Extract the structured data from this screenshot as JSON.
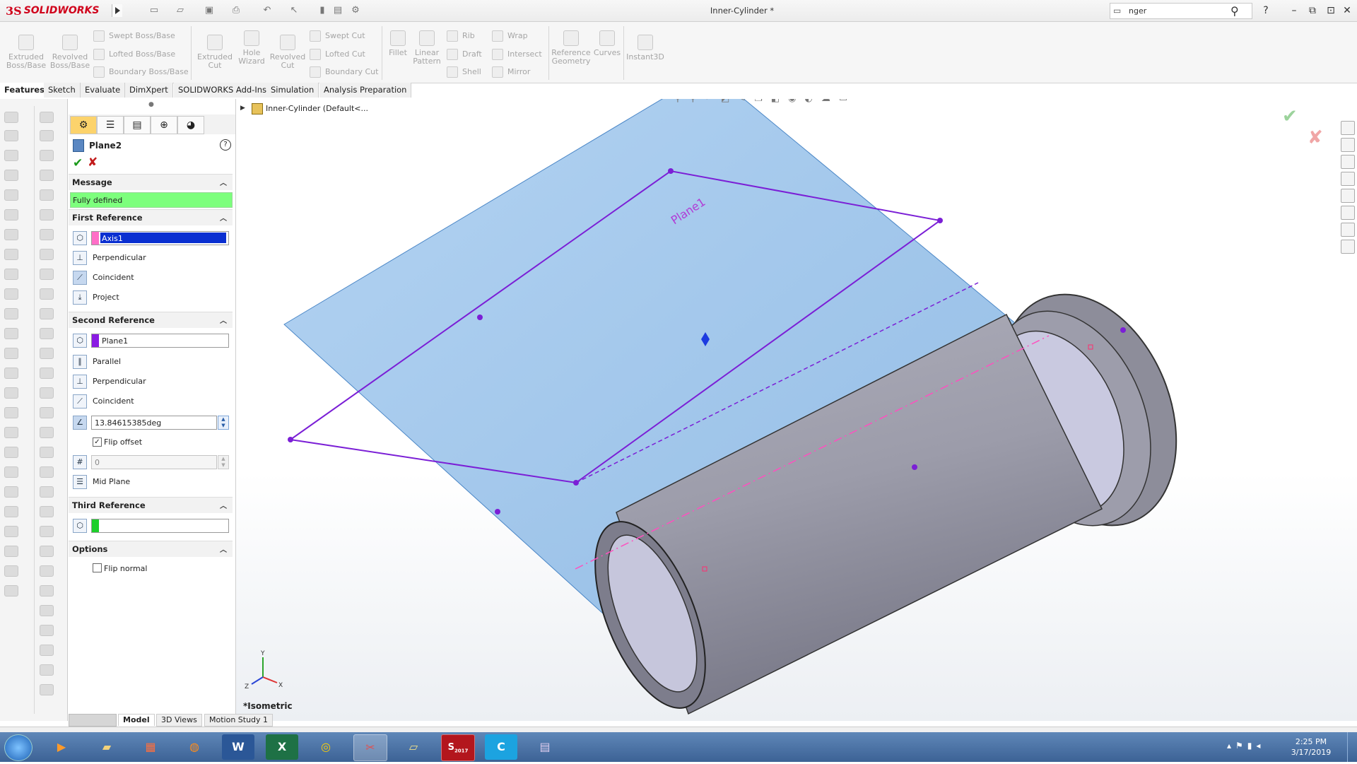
{
  "app": {
    "logo_ds": "3S",
    "logo_text": "SOLIDWORKS",
    "document_title": "Inner-Cylinder *"
  },
  "search": {
    "value": "nger"
  },
  "window_controls": {
    "help": "?",
    "minimize": "–",
    "restore": "⧉",
    "close": "✕"
  },
  "command_manager": {
    "big_tools": [
      {
        "label": "Extruded\nBoss/Base"
      },
      {
        "label": "Revolved\nBoss/Base"
      },
      {
        "label": "Extruded\nCut"
      },
      {
        "label": "Hole\nWizard"
      },
      {
        "label": "Revolved\nCut"
      },
      {
        "label": "Fillet"
      },
      {
        "label": "Linear\nPattern"
      },
      {
        "label": "Reference\nGeometry"
      },
      {
        "label": "Curves"
      },
      {
        "label": "Instant3D"
      }
    ],
    "small_tools": {
      "swept_boss": "Swept Boss/Base",
      "lofted_boss": "Lofted Boss/Base",
      "boundary_boss": "Boundary Boss/Base",
      "swept_cut": "Swept Cut",
      "lofted_cut": "Lofted Cut",
      "boundary_cut": "Boundary Cut",
      "rib": "Rib",
      "draft": "Draft",
      "shell": "Shell",
      "wrap": "Wrap",
      "intersect": "Intersect",
      "mirror": "Mirror"
    }
  },
  "tabs": [
    "Features",
    "Sketch",
    "Evaluate",
    "DimXpert",
    "SOLIDWORKS Add-Ins",
    "Simulation",
    "Analysis Preparation"
  ],
  "property_manager": {
    "title": "Plane2",
    "help": "?",
    "message_header": "Message",
    "message": "Fully defined",
    "first_ref": {
      "header": "First Reference",
      "selection": "Axis1",
      "opt1": "Perpendicular",
      "opt2": "Coincident",
      "opt3": "Project"
    },
    "second_ref": {
      "header": "Second Reference",
      "selection": "Plane1",
      "opt1": "Parallel",
      "opt2": "Perpendicular",
      "opt3": "Coincident",
      "angle": "13.84615385deg",
      "flip_offset": "Flip offset",
      "count": "0",
      "mid_plane": "Mid Plane"
    },
    "third_ref": {
      "header": "Third Reference",
      "selection": ""
    },
    "options": {
      "header": "Options",
      "flip_normal": "Flip normal"
    }
  },
  "feature_tree": {
    "item": "Inner-Cylinder  (Default<..."
  },
  "viewport": {
    "plane_label": "Plane1",
    "view_name": "*Isometric",
    "triad": {
      "x": "X",
      "y": "Y",
      "z": "Z"
    }
  },
  "bottom_tabs": [
    "Model",
    "3D Views",
    "Motion Study 1"
  ],
  "taskbar": {
    "clock_time": "2:25 PM",
    "clock_date": "3/17/2019",
    "sw_badge": "2017"
  },
  "colors": {
    "plane_fill": "#a9cdef",
    "plane_edge": "#4a86c6",
    "preview_plane": "#7b1fd6",
    "part": "#9b9ba8",
    "message_bg": "#7dff7d",
    "brand": "#d0021b"
  }
}
